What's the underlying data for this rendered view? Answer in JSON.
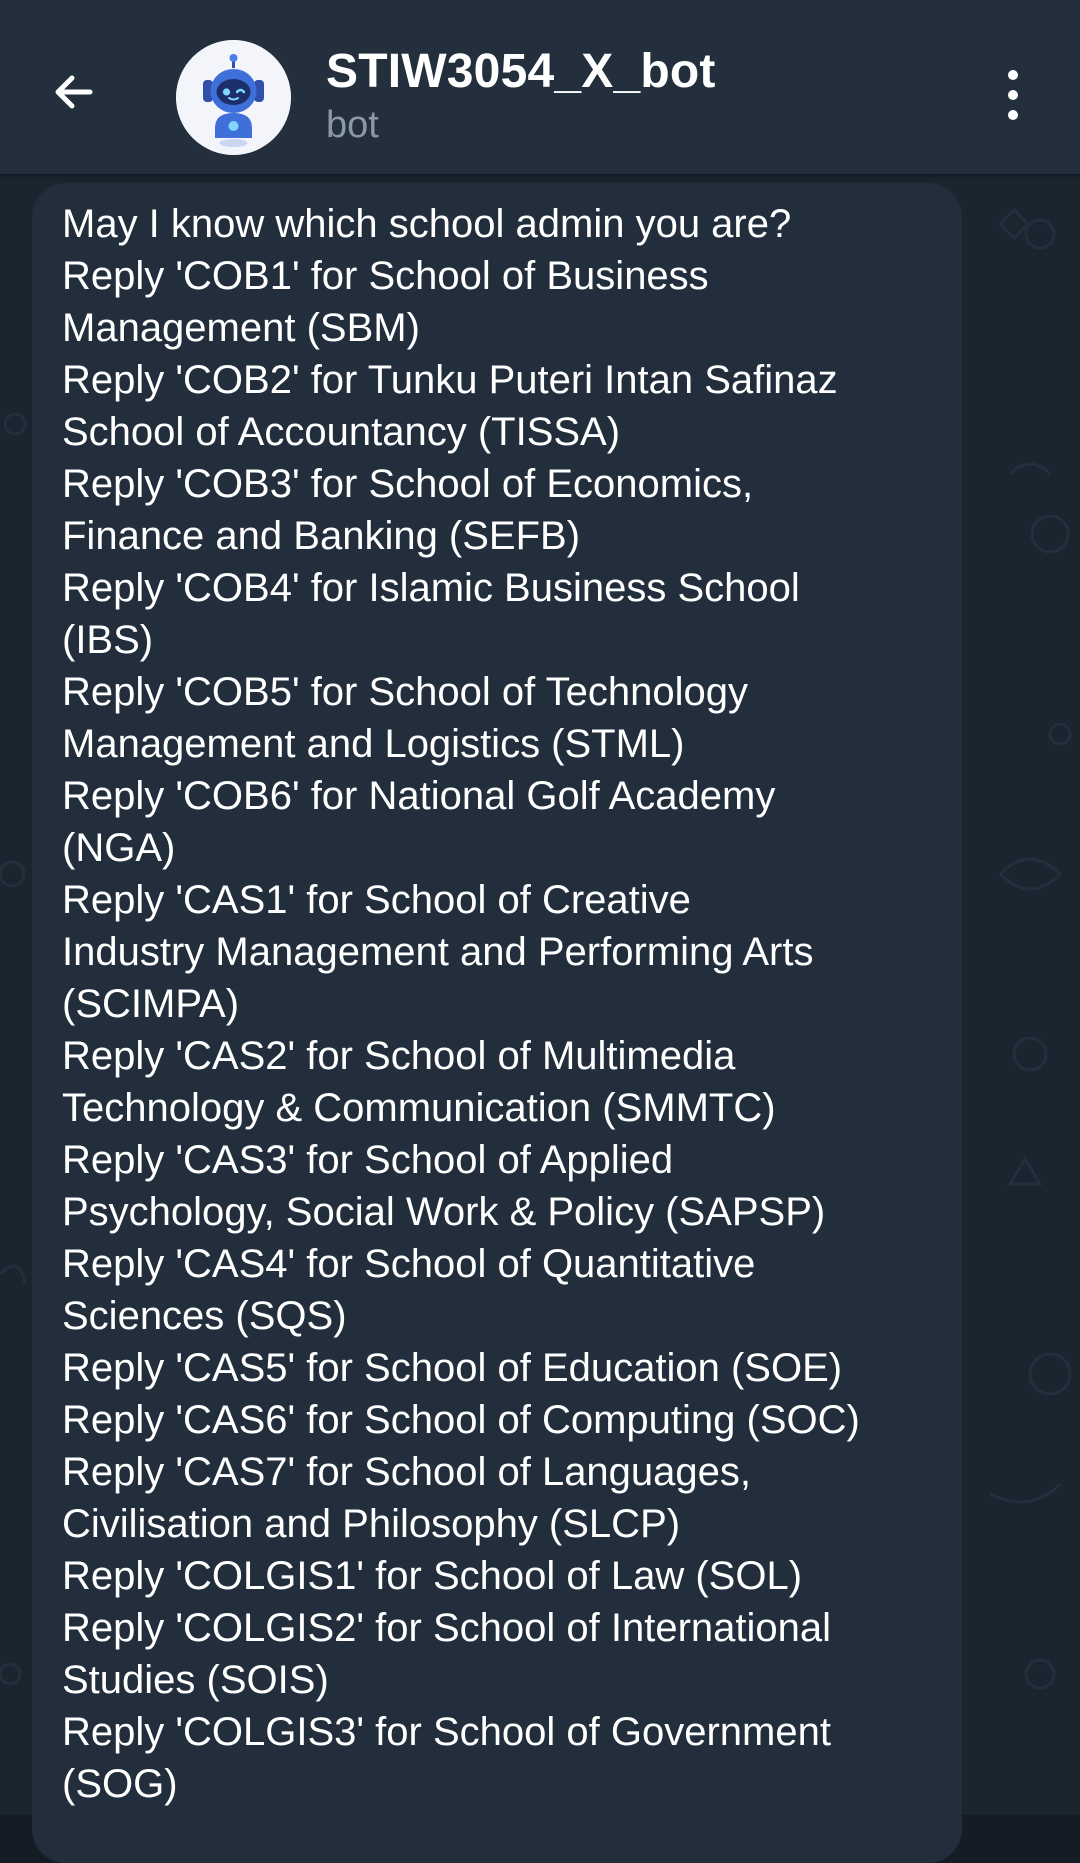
{
  "header": {
    "title": "STIW3054_X_bot",
    "subtitle": "bot",
    "back_icon": "arrow-left-icon",
    "menu_icon": "more-vertical-icon",
    "avatar_icon": "robot-icon"
  },
  "message": {
    "text": "May I know which school admin you are?\nReply 'COB1' for School of Business\nManagement (SBM)\nReply 'COB2' for Tunku Puteri Intan Safinaz\nSchool of Accountancy (TISSA)\nReply 'COB3' for School of Economics,\nFinance and Banking (SEFB)\nReply 'COB4' for Islamic Business School\n(IBS)\nReply 'COB5' for School of Technology\nManagement and Logistics (STML)\nReply 'COB6' for National Golf Academy\n(NGA)\nReply 'CAS1' for School of Creative\nIndustry Management and Performing Arts\n(SCIMPA)\nReply 'CAS2' for School of Multimedia\nTechnology & Communication (SMMTC)\nReply 'CAS3' for School of Applied\nPsychology, Social Work & Policy (SAPSP)\nReply 'CAS4' for School of Quantitative\nSciences (SQS)\nReply 'CAS5' for School of Education (SOE)\nReply 'CAS6' for School of Computing (SOC)\nReply 'CAS7' for School of Languages,\nCivilisation and Philosophy (SLCP)\nReply 'COLGIS1' for School of Law (SOL)\nReply 'COLGIS2' for School of International\nStudies (SOIS)\nReply 'COLGIS3' for School of Government\n(SOG)"
  },
  "colors": {
    "header_bg": "#232f3c",
    "chat_bg": "#1a2530",
    "bubble_bg": "#222e3b",
    "subtitle": "#8a98a8",
    "text": "#ffffff"
  }
}
